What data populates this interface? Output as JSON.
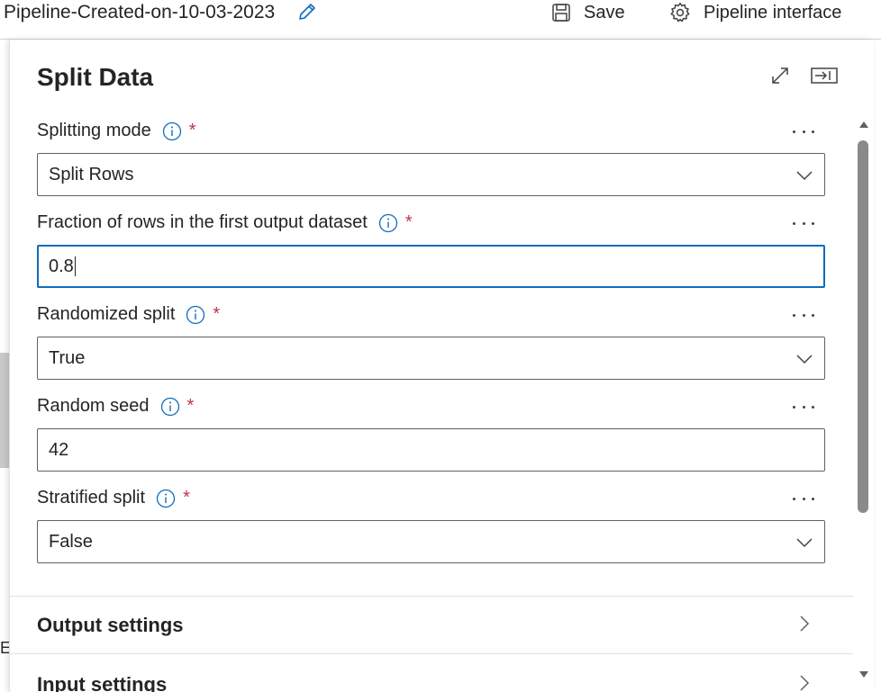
{
  "topbar": {
    "pipeline_title": "Pipeline-Created-on-10-03-2023",
    "save_label": "Save",
    "pipeline_interface_label": "Pipeline interface",
    "background_fragment": "E"
  },
  "panel": {
    "title": "Split Data",
    "fields": [
      {
        "label": "Splitting mode",
        "required_mark": "*",
        "value": "Split Rows",
        "type": "dropdown"
      },
      {
        "label": "Fraction of rows in the first output dataset",
        "required_mark": "*",
        "value": "0.8",
        "type": "text-focused"
      },
      {
        "label": "Randomized split",
        "required_mark": "*",
        "value": "True",
        "type": "dropdown"
      },
      {
        "label": "Random seed",
        "required_mark": "*",
        "value": "42",
        "type": "text"
      },
      {
        "label": "Stratified split",
        "required_mark": "*",
        "value": "False",
        "type": "dropdown"
      }
    ],
    "sections": [
      {
        "title": "Output settings"
      },
      {
        "title": "Input settings"
      }
    ]
  },
  "colors": {
    "accent": "#0f6cbd",
    "required": "#c4314b",
    "text": "#242424"
  },
  "icons": [
    "edit-icon",
    "save-icon",
    "gear-icon",
    "expand-icon",
    "collapse-panel-icon",
    "info-icon",
    "chevron-down-icon",
    "chevron-right-icon",
    "more-icon"
  ]
}
